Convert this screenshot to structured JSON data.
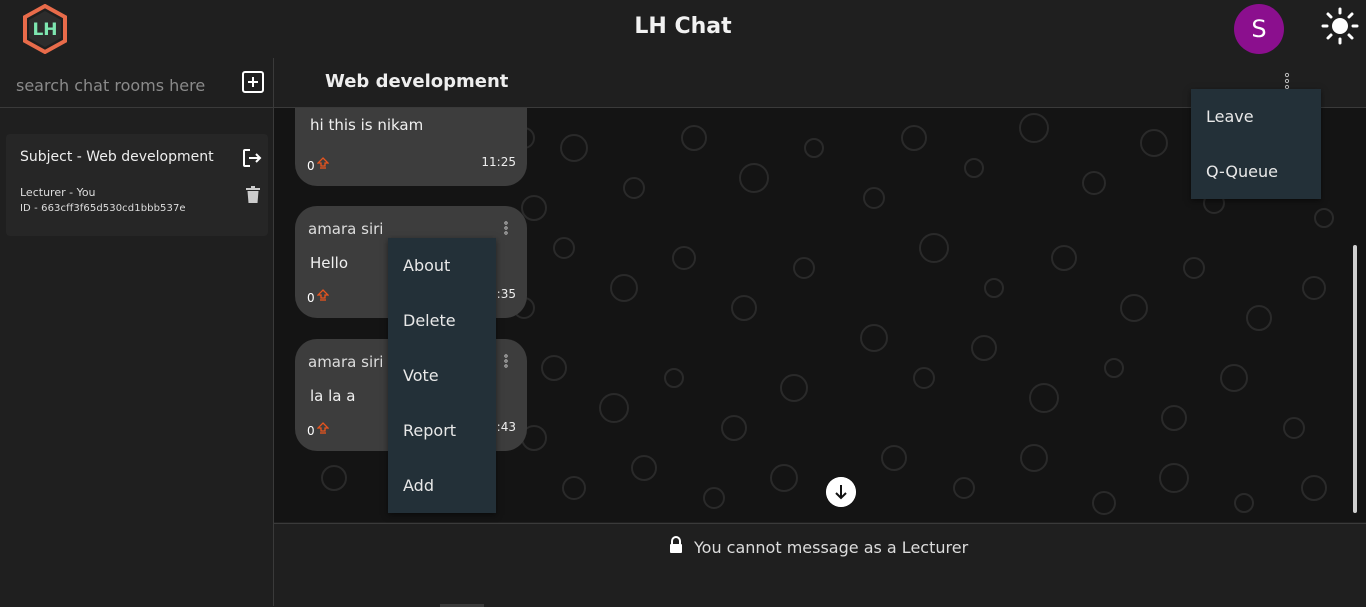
{
  "header": {
    "app_title": "LH Chat",
    "logo_text": "LH",
    "avatar_initial": "S",
    "avatar_color": "#8b0f8e",
    "theme_icon": "sun-icon"
  },
  "sidebar": {
    "search_placeholder": "search chat rooms here",
    "add_icon": "plus-square-icon",
    "rooms": [
      {
        "subject": "Subject - Web development",
        "lecturer": "Lecturer - You",
        "id": "ID - 663cff3f65d530cd1bbb537e",
        "exit_icon": "logout-icon",
        "delete_icon": "trash-icon"
      }
    ]
  },
  "chat": {
    "title": "Web development",
    "messages": [
      {
        "sender": "",
        "text": "hi this is nikam",
        "votes": "0",
        "time": "11:25"
      },
      {
        "sender": "amara siri",
        "text": "Hello",
        "votes": "0",
        "time": "11:35"
      },
      {
        "sender": "amara siri",
        "text": "la la a",
        "votes": "0",
        "time": "11:43"
      }
    ],
    "vote_icon": "upvote-arrow-icon",
    "vote_color": "#e8541e"
  },
  "message_menu": {
    "items": [
      "About",
      "Delete",
      "Vote",
      "Report",
      "Add"
    ]
  },
  "room_menu": {
    "items": [
      "Leave",
      "Q-Queue"
    ]
  },
  "footer": {
    "notice": "You cannot message as a Lecturer",
    "icon": "lock-icon"
  }
}
